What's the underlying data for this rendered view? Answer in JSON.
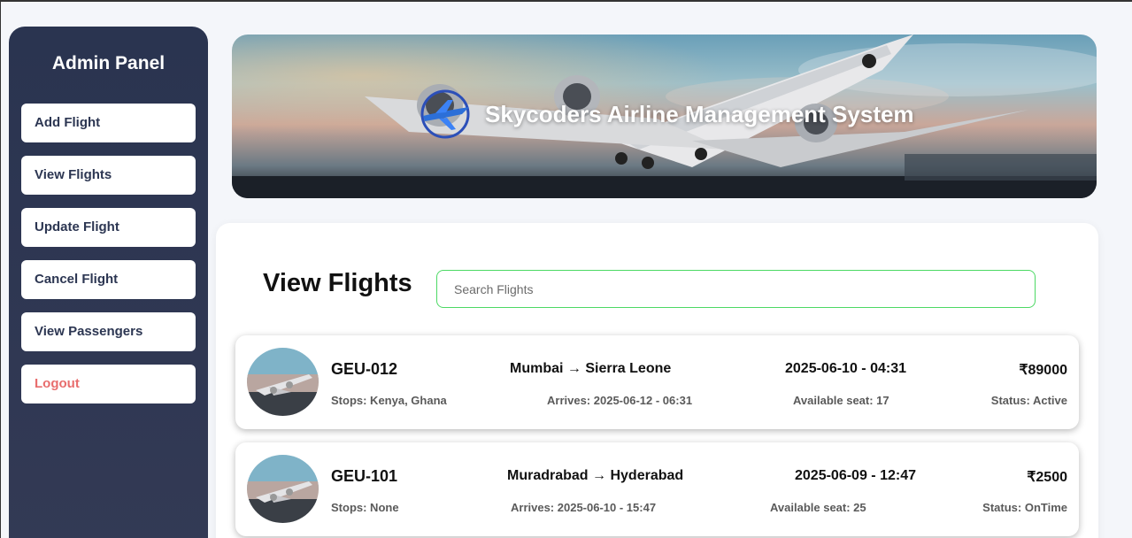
{
  "sidebar": {
    "title": "Admin Panel",
    "items": [
      {
        "label": "Add Flight"
      },
      {
        "label": "View Flights"
      },
      {
        "label": "Update Flight"
      },
      {
        "label": "Cancel Flight"
      },
      {
        "label": "View Passengers"
      },
      {
        "label": "Logout"
      }
    ]
  },
  "banner": {
    "title": "Skycoders Airline Management System"
  },
  "main": {
    "heading": "View Flights",
    "search_placeholder": "Search Flights"
  },
  "flights": [
    {
      "code": "GEU-012",
      "route": "Mumbai → Sierra Leone",
      "departure": "2025-06-10 - 04:31",
      "price": "₹89000",
      "stops": "Stops: Kenya, Ghana",
      "arrives": "Arrives: 2025-06-12 - 06:31",
      "seats": "Available seat: 17",
      "status": "Status: Active"
    },
    {
      "code": "GEU-101",
      "route": "Muradrabad → Hyderabad",
      "departure": "2025-06-09 - 12:47",
      "price": "₹2500",
      "stops": "Stops: None",
      "arrives": "Arrives: 2025-06-10 - 15:47",
      "seats": "Available seat: 25",
      "status": "Status: OnTime"
    }
  ],
  "colors": {
    "sidebar_bg": "#2a3450",
    "logout_text": "#e86d6d",
    "search_border": "#4cd964"
  }
}
